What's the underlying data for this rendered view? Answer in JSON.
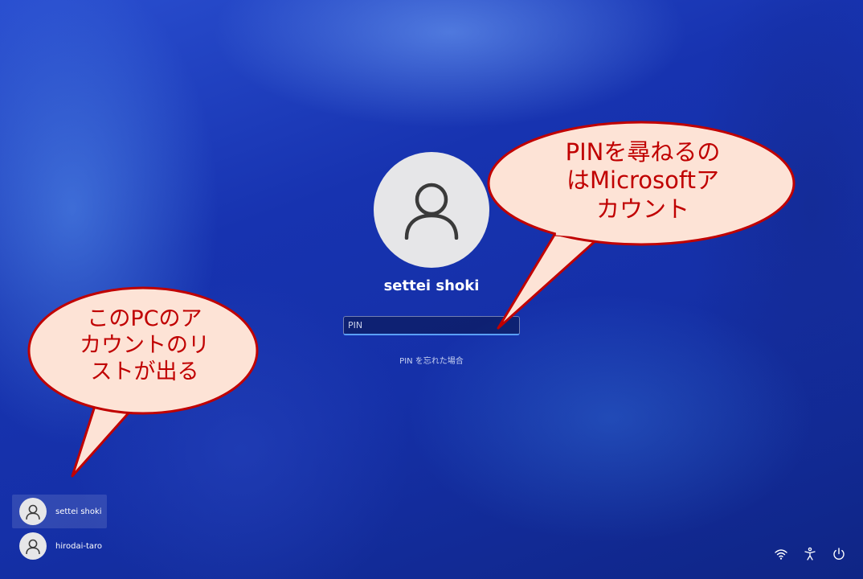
{
  "login": {
    "username": "settei shoki",
    "pin_placeholder": "PIN",
    "forgot_pin": "PIN を忘れた場合"
  },
  "accounts": [
    {
      "name": "settei shoki",
      "selected": true
    },
    {
      "name": "hirodai-taro",
      "selected": false
    }
  ],
  "callouts": {
    "right": [
      "PINを尋ねるの",
      "はMicrosoftア",
      "カウント"
    ],
    "left": [
      "このPCのア",
      "カウントのリ",
      "ストが出る"
    ]
  },
  "tray": [
    "wifi-icon",
    "accessibility-icon",
    "power-icon"
  ],
  "colors": {
    "callout_fill": "#fde3d6",
    "callout_border": "#c00000",
    "callout_text": "#c00000",
    "input_accent": "#5aa0ff"
  }
}
